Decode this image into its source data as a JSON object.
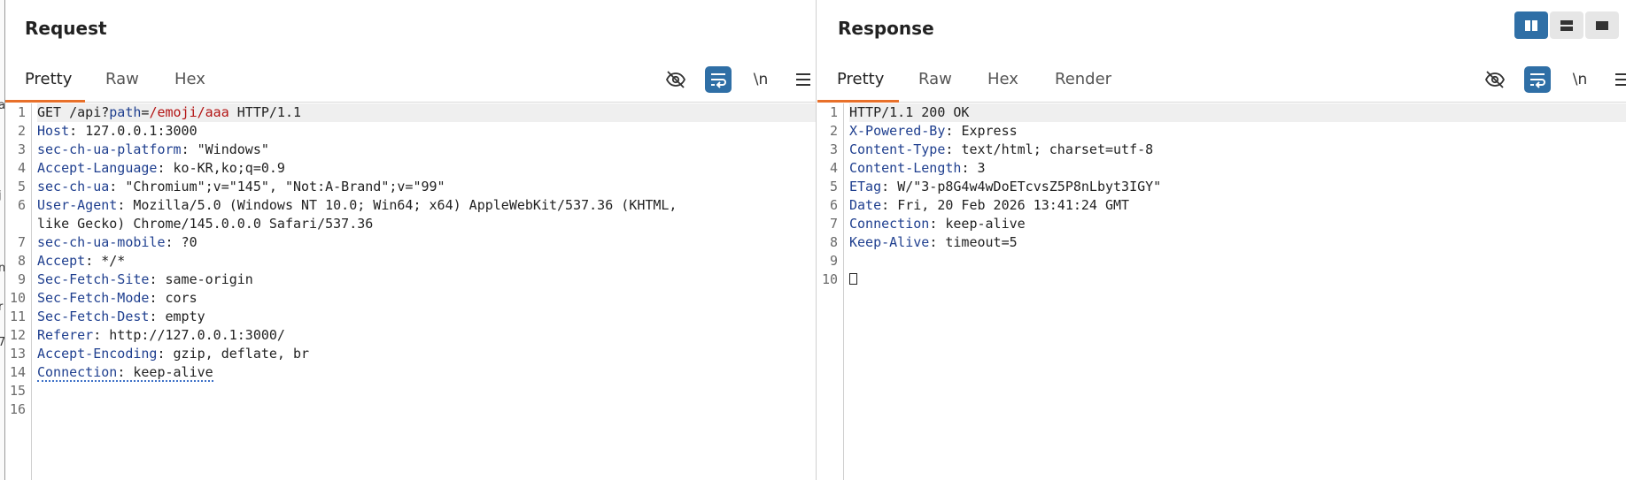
{
  "edge_letters": [
    "a",
    "j",
    "n",
    "r",
    "7"
  ],
  "request": {
    "title": "Request",
    "tabs": [
      "Pretty",
      "Raw",
      "Hex"
    ],
    "active_tab": "Pretty",
    "tools": {
      "hide_icon": "eye-slash-icon",
      "wrap_icon": "word-wrap-icon",
      "newline_label": "\\n",
      "menu_icon": "hamburger-menu-icon"
    },
    "request_line": {
      "method": "GET",
      "path_prefix": " /api?",
      "param_name": "path",
      "equals": "=",
      "param_value": "/emoji/aaa",
      "version": " HTTP/1.1"
    },
    "headers": [
      {
        "name": "Host",
        "value": "127.0.0.1:3000"
      },
      {
        "name": "sec-ch-ua-platform",
        "value": "\"Windows\""
      },
      {
        "name": "Accept-Language",
        "value": "ko-KR,ko;q=0.9"
      },
      {
        "name": "sec-ch-ua",
        "value": "\"Chromium\";v=\"145\", \"Not:A-Brand\";v=\"99\""
      },
      {
        "name": "User-Agent",
        "value": "Mozilla/5.0 (Windows NT 10.0; Win64; x64) AppleWebKit/537.36 (KHTML,",
        "continuation": "like Gecko) Chrome/145.0.0.0 Safari/537.36"
      },
      {
        "name": "sec-ch-ua-mobile",
        "value": "?0"
      },
      {
        "name": "Accept",
        "value": "*/*"
      },
      {
        "name": "Sec-Fetch-Site",
        "value": "same-origin"
      },
      {
        "name": "Sec-Fetch-Mode",
        "value": "cors"
      },
      {
        "name": "Sec-Fetch-Dest",
        "value": "empty"
      },
      {
        "name": "Referer",
        "value": "http://127.0.0.1:3000/"
      },
      {
        "name": "Accept-Encoding",
        "value": "gzip, deflate, br"
      },
      {
        "name": "Connection",
        "value": "keep-alive"
      }
    ],
    "line_numbers": [
      "1",
      "2",
      "3",
      "4",
      "5",
      "6",
      "7",
      "8",
      "9",
      "10",
      "11",
      "12",
      "13",
      "14",
      "15",
      "16"
    ]
  },
  "response": {
    "title": "Response",
    "tabs": [
      "Pretty",
      "Raw",
      "Hex",
      "Render"
    ],
    "active_tab": "Pretty",
    "layout_icons": [
      "split-columns-icon",
      "split-rows-icon",
      "single-pane-icon"
    ],
    "tools": {
      "hide_icon": "eye-slash-icon",
      "wrap_icon": "word-wrap-icon",
      "newline_label": "\\n",
      "menu_icon": "hamburger-menu-icon"
    },
    "status_line": "HTTP/1.1 200 OK",
    "headers": [
      {
        "name": "X-Powered-By",
        "value": "Express"
      },
      {
        "name": "Content-Type",
        "value": "text/html; charset=utf-8"
      },
      {
        "name": "Content-Length",
        "value": "3"
      },
      {
        "name": "ETag",
        "value": "W/\"3-p8G4w4wDoETcvsZ5P8nLbyt3IGY\""
      },
      {
        "name": "Date",
        "value": "Fri, 20 Feb 2026 13:41:24 GMT"
      },
      {
        "name": "Connection",
        "value": "keep-alive"
      },
      {
        "name": "Keep-Alive",
        "value": "timeout=5"
      }
    ],
    "line_numbers": [
      "1",
      "2",
      "3",
      "4",
      "5",
      "6",
      "7",
      "8",
      "9",
      "10"
    ]
  },
  "colors": {
    "accent": "#e8702a",
    "active_button": "#2f6fa6",
    "header_name": "#1f3f8f",
    "param_value": "#b31414"
  }
}
